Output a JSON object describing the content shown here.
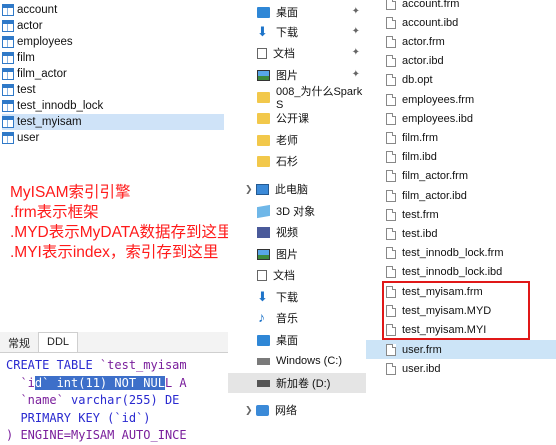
{
  "tables": [
    {
      "name": "account",
      "selected": false
    },
    {
      "name": "actor",
      "selected": false
    },
    {
      "name": "employees",
      "selected": false
    },
    {
      "name": "film",
      "selected": false
    },
    {
      "name": "film_actor",
      "selected": false
    },
    {
      "name": "test",
      "selected": false
    },
    {
      "name": "test_innodb_lock",
      "selected": false
    },
    {
      "name": "test_myisam",
      "selected": true
    },
    {
      "name": "user",
      "selected": false
    }
  ],
  "annotation": {
    "lines": [
      "MyISAM索引引擎",
      ".frm表示框架",
      ".MYD表示MyDATA数据存到这里",
      ".MYI表示index，索引存到这里"
    ],
    "color": "#ff1a1a"
  },
  "tabs": [
    {
      "label": "常规",
      "active": false
    },
    {
      "label": "DDL",
      "active": true
    }
  ],
  "ddl": {
    "line1_kw": "CREATE TABLE",
    "line1_rest": " `test_myisam",
    "line2_a": "  `i",
    "line2_hl": "d` int(11) NOT NUL",
    "line2_b": "L A",
    "line3_a": "  `name` ",
    "line3_b": "varchar(255) DE",
    "line4": "  PRIMARY KEY (`id`)",
    "line5": ") ENGINE=MyISAM AUTO_INCE"
  },
  "nav": [
    {
      "label": "桌面",
      "icon": "desktop-icon",
      "pinned": true
    },
    {
      "label": "下载",
      "icon": "download-icon",
      "pinned": true
    },
    {
      "label": "文档",
      "icon": "document-icon",
      "pinned": true
    },
    {
      "label": "图片",
      "icon": "picture-icon",
      "pinned": true
    },
    {
      "label": "008_为什么Spark S",
      "icon": "folder-icon",
      "pinned": false
    },
    {
      "label": "公开课",
      "icon": "folder-icon",
      "pinned": false
    },
    {
      "label": "老师",
      "icon": "folder-icon",
      "pinned": false
    },
    {
      "label": "石杉",
      "icon": "folder-icon",
      "pinned": false
    },
    {
      "label": "此电脑",
      "icon": "computer-icon",
      "pinned": false
    },
    {
      "label": "3D 对象",
      "icon": "3d-objects-icon",
      "pinned": false
    },
    {
      "label": "视频",
      "icon": "video-icon",
      "pinned": false
    },
    {
      "label": "图片",
      "icon": "picture-icon",
      "pinned": false
    },
    {
      "label": "文档",
      "icon": "document-icon",
      "pinned": false
    },
    {
      "label": "下载",
      "icon": "download-icon",
      "pinned": false
    },
    {
      "label": "音乐",
      "icon": "music-icon",
      "pinned": false
    },
    {
      "label": "桌面",
      "icon": "desktop-icon",
      "pinned": false
    },
    {
      "label": "Windows (C:)",
      "icon": "drive-icon",
      "pinned": false
    },
    {
      "label": "新加卷 (D:)",
      "icon": "drive-icon",
      "pinned": false
    },
    {
      "label": "网络",
      "icon": "network-icon",
      "pinned": false
    }
  ],
  "files": [
    {
      "name": "account.frm",
      "selected": false
    },
    {
      "name": "account.ibd",
      "selected": false
    },
    {
      "name": "actor.frm",
      "selected": false
    },
    {
      "name": "actor.ibd",
      "selected": false
    },
    {
      "name": "db.opt",
      "selected": false
    },
    {
      "name": "employees.frm",
      "selected": false
    },
    {
      "name": "employees.ibd",
      "selected": false
    },
    {
      "name": "film.frm",
      "selected": false
    },
    {
      "name": "film.ibd",
      "selected": false
    },
    {
      "name": "film_actor.frm",
      "selected": false
    },
    {
      "name": "film_actor.ibd",
      "selected": false
    },
    {
      "name": "test.frm",
      "selected": false
    },
    {
      "name": "test.ibd",
      "selected": false
    },
    {
      "name": "test_innodb_lock.frm",
      "selected": false
    },
    {
      "name": "test_innodb_lock.ibd",
      "selected": false
    },
    {
      "name": "test_myisam.frm",
      "selected": false
    },
    {
      "name": "test_myisam.MYD",
      "selected": false
    },
    {
      "name": "test_myisam.MYI",
      "selected": false
    },
    {
      "name": "user.frm",
      "selected": true
    },
    {
      "name": "user.ibd",
      "selected": false
    }
  ],
  "highlight_color": "#e01818"
}
